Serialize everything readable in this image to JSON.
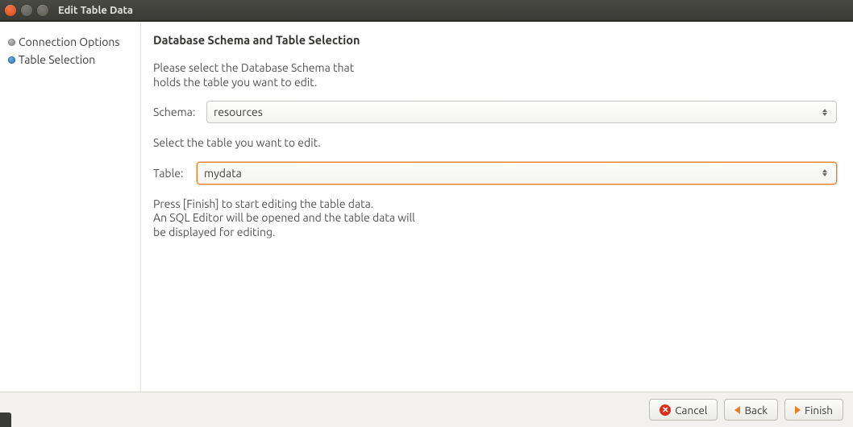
{
  "window": {
    "title": "Edit Table Data"
  },
  "sidebar": {
    "items": [
      {
        "label": "Connection Options",
        "active": false
      },
      {
        "label": "Table Selection",
        "active": true
      }
    ]
  },
  "main": {
    "heading": "Database Schema and Table Selection",
    "intro1": "Please select the Database Schema that",
    "intro2": "holds the table you want to edit.",
    "schema_label": "Schema:",
    "schema_value": "resources",
    "select_table_text": "Select the table you want to edit.",
    "table_label": "Table:",
    "table_value": "mydata",
    "outro1": "Press [Finish] to start editing the table data.",
    "outro2": "An SQL Editor will be opened and the table data will",
    "outro3": "be displayed for editing."
  },
  "buttons": {
    "cancel": "Cancel",
    "back": "Back",
    "finish": "Finish"
  }
}
